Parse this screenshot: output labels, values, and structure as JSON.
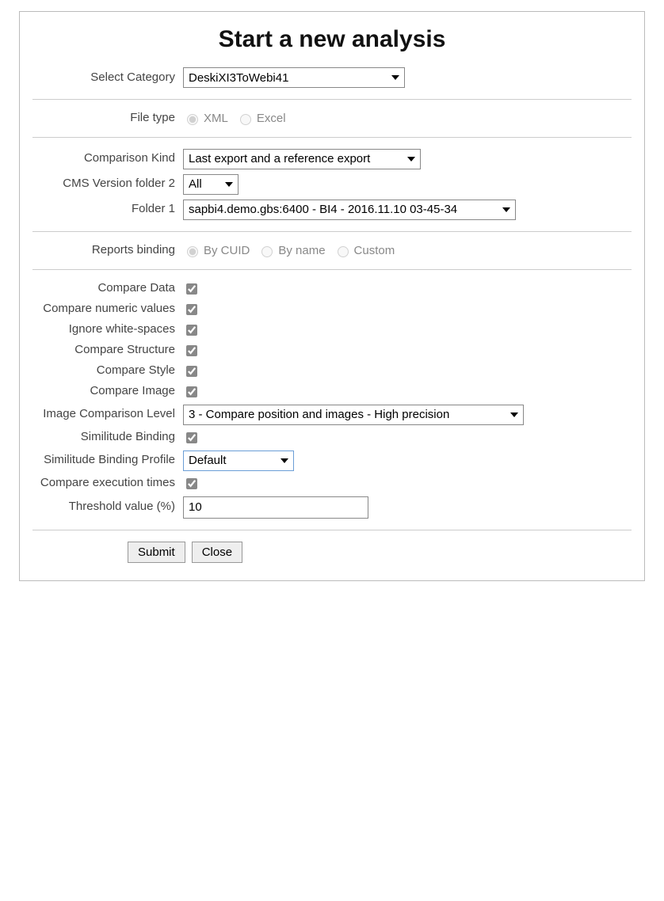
{
  "title": "Start a new analysis",
  "labels": {
    "select_category": "Select Category",
    "file_type": "File type",
    "comparison_kind": "Comparison Kind",
    "cms_version_folder2": "CMS Version folder 2",
    "folder1": "Folder 1",
    "reports_binding": "Reports binding",
    "compare_data": "Compare Data",
    "compare_numeric": "Compare numeric values",
    "ignore_ws": "Ignore white-spaces",
    "compare_structure": "Compare Structure",
    "compare_style": "Compare Style",
    "compare_image": "Compare Image",
    "image_comp_level": "Image Comparison Level",
    "similitude_binding": "Similitude Binding",
    "similitude_binding_profile": "Similitude Binding Profile",
    "compare_exec_times": "Compare execution times",
    "threshold": "Threshold value (%)"
  },
  "select_category": {
    "selected": "DeskiXI3ToWebi41"
  },
  "file_type": {
    "options": {
      "xml": "XML",
      "excel": "Excel"
    },
    "selected": "xml"
  },
  "comparison_kind": {
    "selected": "Last export and a reference export"
  },
  "cms_version_folder2": {
    "selected": "All"
  },
  "folder1": {
    "selected": "sapbi4.demo.gbs:6400 - BI4 - 2016.11.10 03-45-34"
  },
  "reports_binding": {
    "options": {
      "by_cuid": "By CUID",
      "by_name": "By name",
      "custom": "Custom"
    },
    "selected": "by_cuid"
  },
  "checks": {
    "compare_data": true,
    "compare_numeric": true,
    "ignore_ws": true,
    "compare_structure": true,
    "compare_style": true,
    "compare_image": true,
    "similitude_binding": true,
    "compare_exec_times": true
  },
  "image_comp_level": {
    "selected": "3 - Compare position and images - High precision"
  },
  "similitude_binding_profile": {
    "selected": "Default"
  },
  "threshold_value": "10",
  "buttons": {
    "submit": "Submit",
    "close": "Close"
  }
}
